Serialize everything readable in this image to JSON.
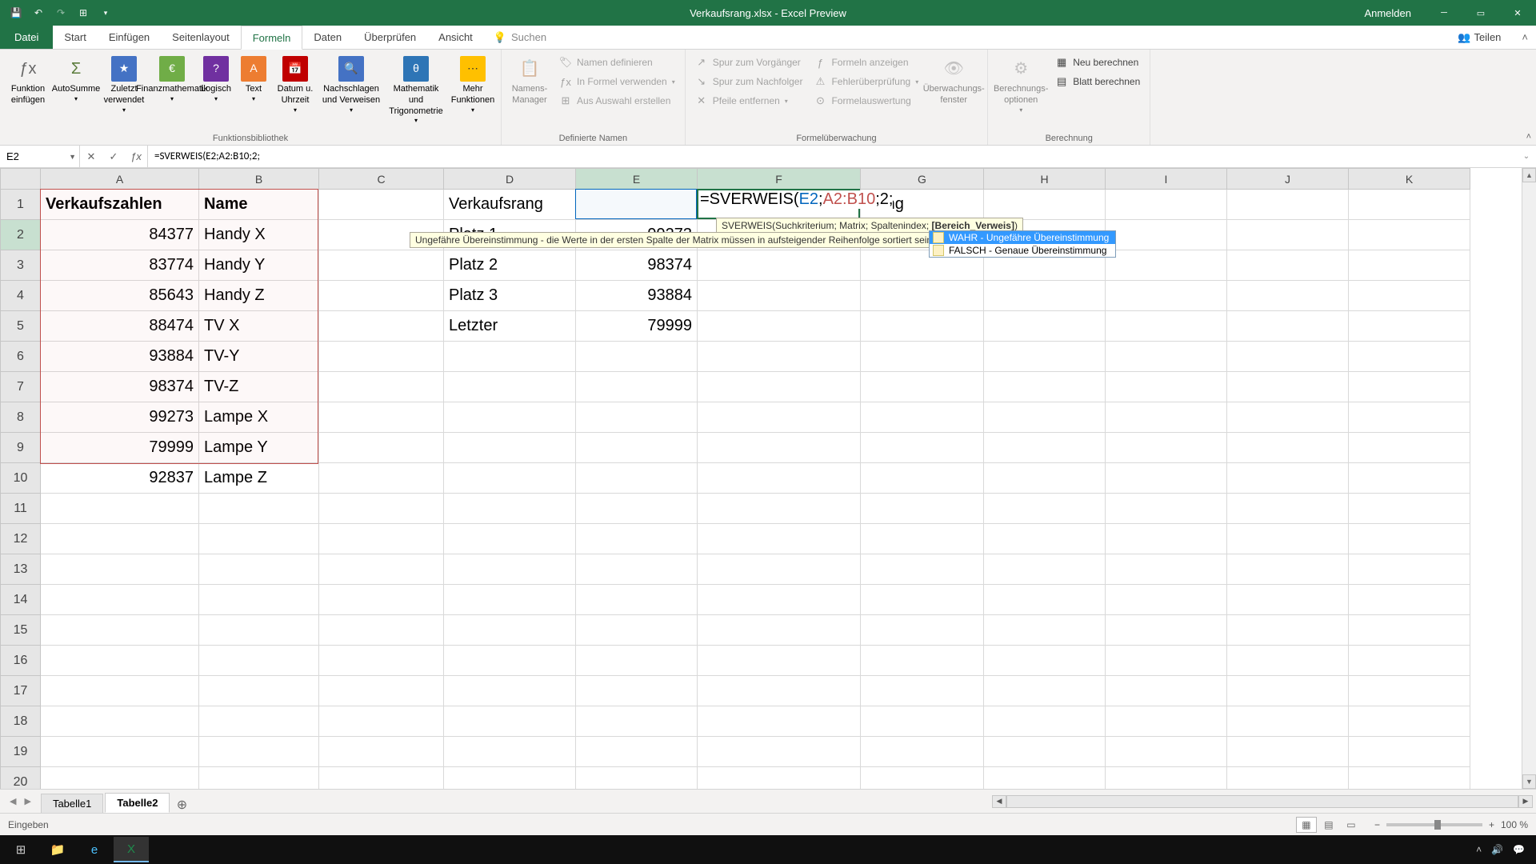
{
  "titlebar": {
    "title": "Verkaufsrang.xlsx - Excel Preview",
    "signin": "Anmelden"
  },
  "ribbon_tabs": {
    "file": "Datei",
    "tabs": [
      "Start",
      "Einfügen",
      "Seitenlayout",
      "Formeln",
      "Daten",
      "Überprüfen",
      "Ansicht"
    ],
    "active_index": 3,
    "tell_me": "Suchen",
    "share": "Teilen"
  },
  "ribbon": {
    "group1": {
      "label": "Funktionsbibliothek",
      "btns": [
        "Funktion einfügen",
        "AutoSumme",
        "Zuletzt verwendet",
        "Finanzmathematik",
        "Logisch",
        "Text",
        "Datum u. Uhrzeit",
        "Nachschlagen und Verweisen",
        "Mathematik und Trigonometrie",
        "Mehr Funktionen"
      ]
    },
    "group2": {
      "label": "Definierte Namen",
      "big": "Namens-Manager",
      "small": [
        "Namen definieren",
        "In Formel verwenden",
        "Aus Auswahl erstellen"
      ]
    },
    "group3": {
      "label": "Formelüberwachung",
      "small_left": [
        "Spur zum Vorgänger",
        "Spur zum Nachfolger",
        "Pfeile entfernen"
      ],
      "small_right": [
        "Formeln anzeigen",
        "Fehlerüberprüfung",
        "Formelauswertung"
      ],
      "big": "Überwachungs-fenster"
    },
    "group4": {
      "label": "Berechnung",
      "big": "Berechnungs-optionen",
      "small": [
        "Neu berechnen",
        "Blatt berechnen"
      ]
    }
  },
  "formula_bar": {
    "name_box": "E2",
    "formula": "=SVERWEIS(E2;A2:B10;2;"
  },
  "grid": {
    "columns": [
      "A",
      "B",
      "C",
      "D",
      "E",
      "F",
      "G",
      "H",
      "I",
      "J",
      "K"
    ],
    "rows_shown": 20,
    "headers": {
      "A1": "Verkaufszahlen",
      "B1": "Name",
      "D1": "Verkaufsrang",
      "G1": "Rang"
    },
    "data_ab": [
      [
        84377,
        "Handy X"
      ],
      [
        83774,
        "Handy Y"
      ],
      [
        85643,
        "Handy Z"
      ],
      [
        88474,
        "TV X"
      ],
      [
        93884,
        "TV-Y"
      ],
      [
        98374,
        "TV-Z"
      ],
      [
        99273,
        "Lampe X"
      ],
      [
        79999,
        "Lampe Y"
      ],
      [
        92837,
        "Lampe Z"
      ]
    ],
    "data_de": [
      [
        "Platz 1",
        99273
      ],
      [
        "Platz 2",
        98374
      ],
      [
        "Platz 3",
        93884
      ],
      [
        "Letzter",
        79999
      ]
    ]
  },
  "formula_edit": {
    "prefix": "=SVERWEIS(",
    "arg1": "E2",
    "sep1": ";",
    "arg2": "A2:B10",
    "sep2": ";",
    "arg3": "2",
    "sep3": ";",
    "syntax": "SVERWEIS(Suchkriterium; Matrix; Spaltenindex; ",
    "syntax_bold": "[Bereich_Verweis]",
    "syntax_close": ")",
    "hint": "Ungefähre Übereinstimmung - die Werte in der ersten Spalte der Matrix müssen in aufsteigender Reihenfolge sortiert sein",
    "ac_wahr": "WAHR - Ungefähre Übereinstimmung",
    "ac_falsch": "FALSCH - Genaue Übereinstimmung"
  },
  "sheets": {
    "tabs": [
      "Tabelle1",
      "Tabelle2"
    ],
    "active_index": 1
  },
  "status": {
    "mode": "Eingeben",
    "zoom": "100 %"
  },
  "colors": {
    "accent": "#217346",
    "blue_ref": "#0065bd",
    "red_ref": "#c0504d"
  }
}
